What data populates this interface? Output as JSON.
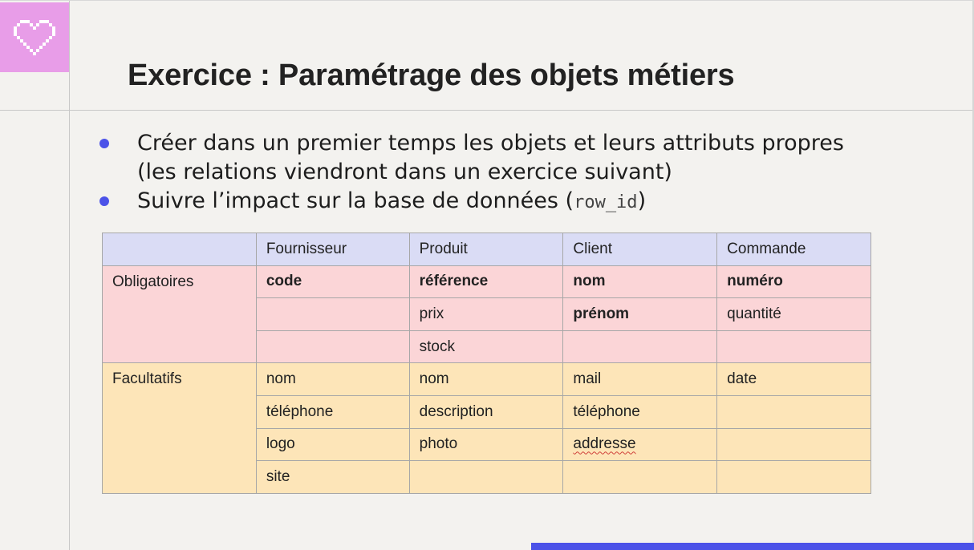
{
  "slide": {
    "title": "Exercice : Paramétrage des objets métiers",
    "bullets": [
      {
        "text": "Créer dans un premier temps les objets et leurs attributs propres (les relations viendront dans un exercice suivant)"
      },
      {
        "text_before": "Suivre l’impact sur la base de données (",
        "code": "row_id",
        "text_after": ")"
      }
    ]
  },
  "table": {
    "headers": [
      "",
      "Fournisseur",
      "Produit",
      "Client",
      "Commande"
    ],
    "obligatoires_label": "Obligatoires",
    "facultatifs_label": "Facultatifs",
    "obligatoires_rows": [
      [
        "code",
        "référence",
        "nom",
        "numéro"
      ],
      [
        "",
        "prix",
        "prénom",
        "quantité"
      ],
      [
        "",
        "stock",
        "",
        ""
      ]
    ],
    "facultatifs_rows": [
      [
        "nom",
        "nom",
        "mail",
        "date"
      ],
      [
        "téléphone",
        "description",
        "téléphone",
        ""
      ],
      [
        "logo",
        "photo",
        "addresse",
        ""
      ],
      [
        "site",
        "",
        "",
        ""
      ]
    ]
  },
  "colors": {
    "accent": "#4b52e8",
    "logo_bg": "#e89de8",
    "header_row": "#dadcf5",
    "required_rows": "#fbd5d7",
    "optional_rows": "#fde5b8"
  },
  "icons": {
    "logo": "pixel-heart-icon"
  }
}
